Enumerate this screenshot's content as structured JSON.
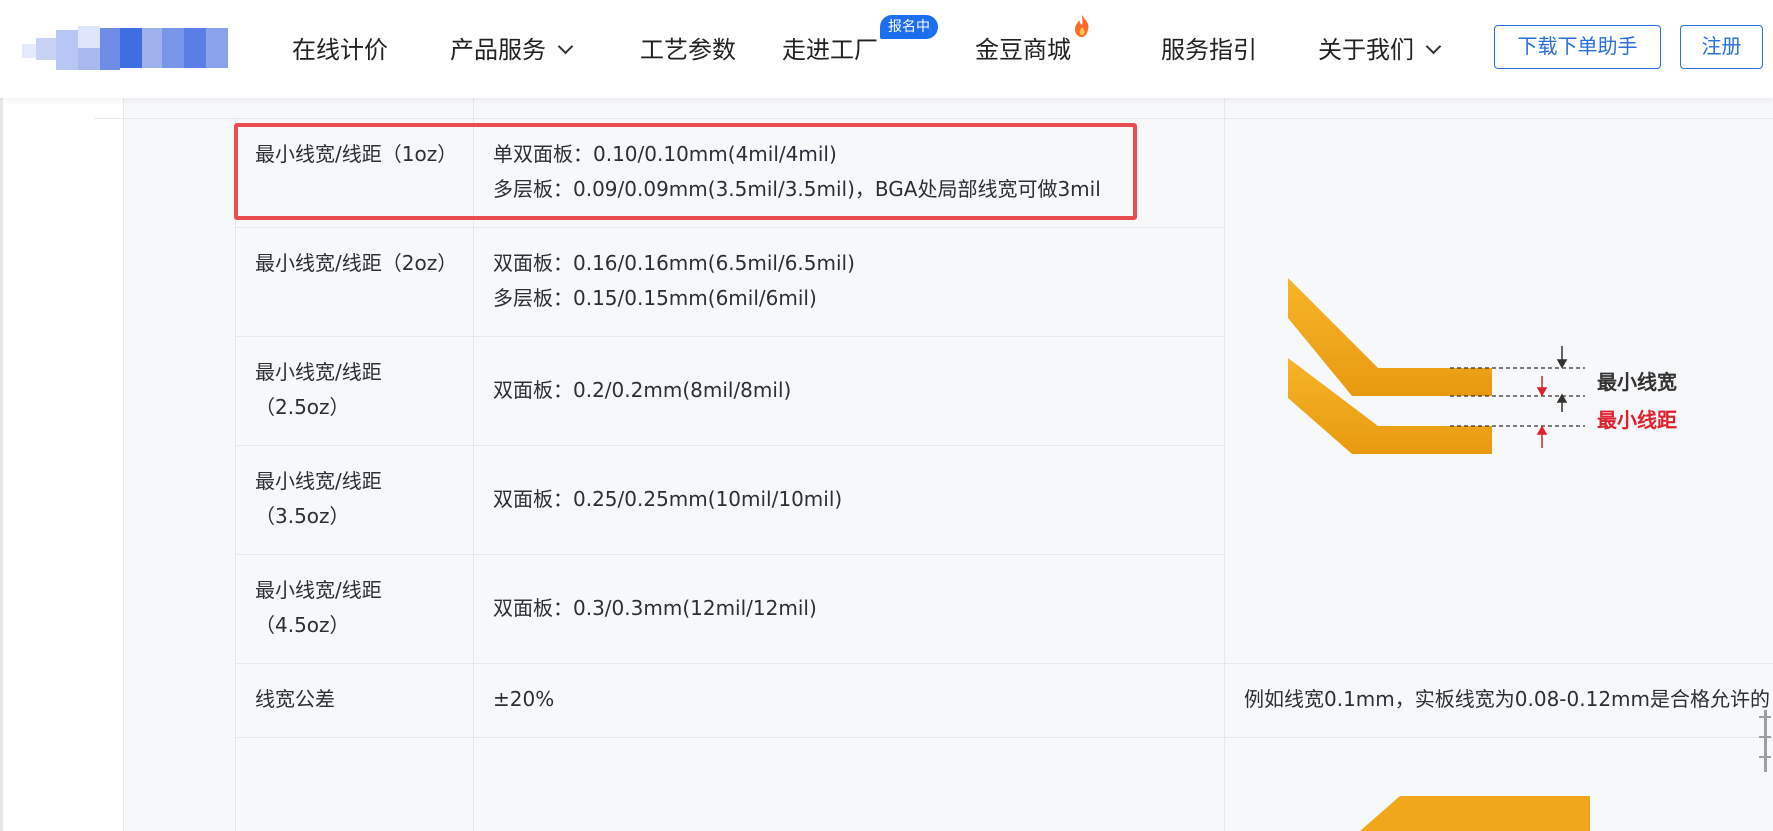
{
  "nav": {
    "items": [
      {
        "label": "在线计价"
      },
      {
        "label": "产品服务"
      },
      {
        "label": "工艺参数"
      },
      {
        "label": "走进工厂"
      },
      {
        "label": "金豆商城"
      },
      {
        "label": "服务指引"
      },
      {
        "label": "关于我们"
      }
    ],
    "badge": "报名中",
    "download_button": "下载下单助手",
    "register_button": "注册"
  },
  "table": {
    "rows": [
      {
        "label": "最小线宽/线距（1oz）",
        "values": [
          "单双面板：0.10/0.10mm(4mil/4mil)",
          "多层板：0.09/0.09mm(3.5mil/3.5mil)，BGA处局部线宽可做3mil"
        ]
      },
      {
        "label": "最小线宽/线距（2oz）",
        "values": [
          "双面板：0.16/0.16mm(6.5mil/6.5mil)",
          "多层板：0.15/0.15mm(6mil/6mil)"
        ]
      },
      {
        "label": "最小线宽/线距（2.5oz）",
        "values": [
          "双面板：0.2/0.2mm(8mil/8mil)"
        ]
      },
      {
        "label": "最小线宽/线距（3.5oz）",
        "values": [
          "双面板：0.25/0.25mm(10mil/10mil)"
        ]
      },
      {
        "label": "最小线宽/线距（4.5oz）",
        "values": [
          "双面板：0.3/0.3mm(12mil/12mil)"
        ]
      },
      {
        "label": "线宽公差",
        "values": [
          "±20%"
        ]
      }
    ],
    "tolerance_note": "例如线宽0.1mm，实板线宽为0.08-0.12mm是合格允许的"
  },
  "diagram": {
    "width_label": "最小线宽",
    "spacing_label": "最小线距",
    "trace_color": "#f0a81a",
    "spacing_color": "#e0202c"
  },
  "colors": {
    "accent": "#2a6fdb",
    "badge": "#1e6ef0",
    "highlight": "#ea4d51"
  }
}
